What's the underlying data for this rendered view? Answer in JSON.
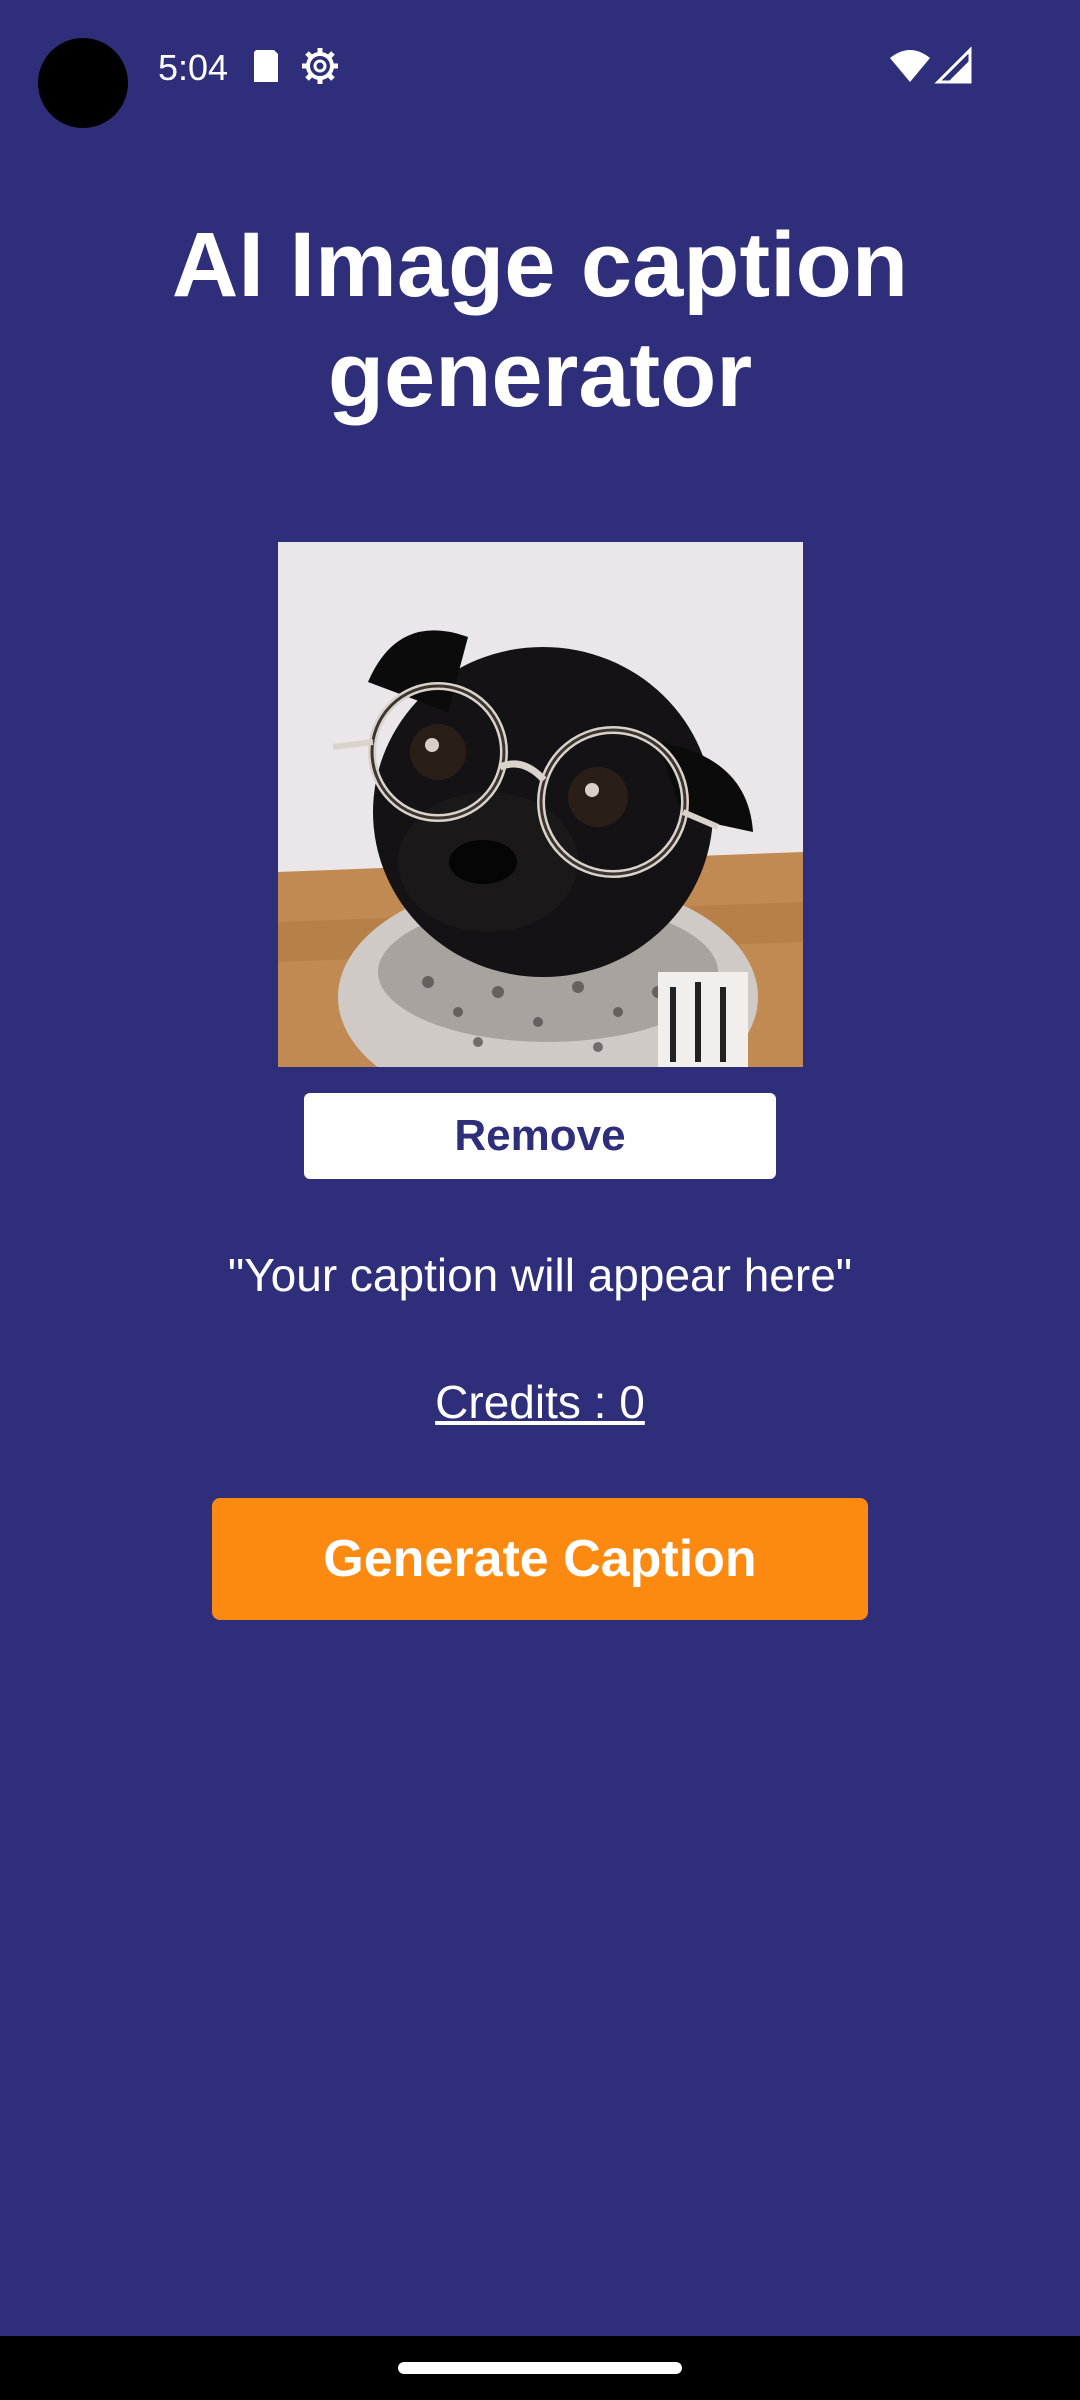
{
  "status_bar": {
    "time": "5:04",
    "icons": [
      "sd-card-icon",
      "settings-icon",
      "wifi-icon",
      "cell-signal-icon"
    ]
  },
  "app": {
    "title": "AI Image caption generator"
  },
  "image": {
    "subject_icon": "pug-photo"
  },
  "actions": {
    "remove_label": "Remove",
    "generate_label": "Generate Caption"
  },
  "caption": {
    "text": "\"Your caption will appear here\""
  },
  "credits": {
    "label": "Credits : 0"
  },
  "colors": {
    "background": "#2e2e7a",
    "accent": "#fd8a10",
    "button_light": "#ffffff"
  }
}
